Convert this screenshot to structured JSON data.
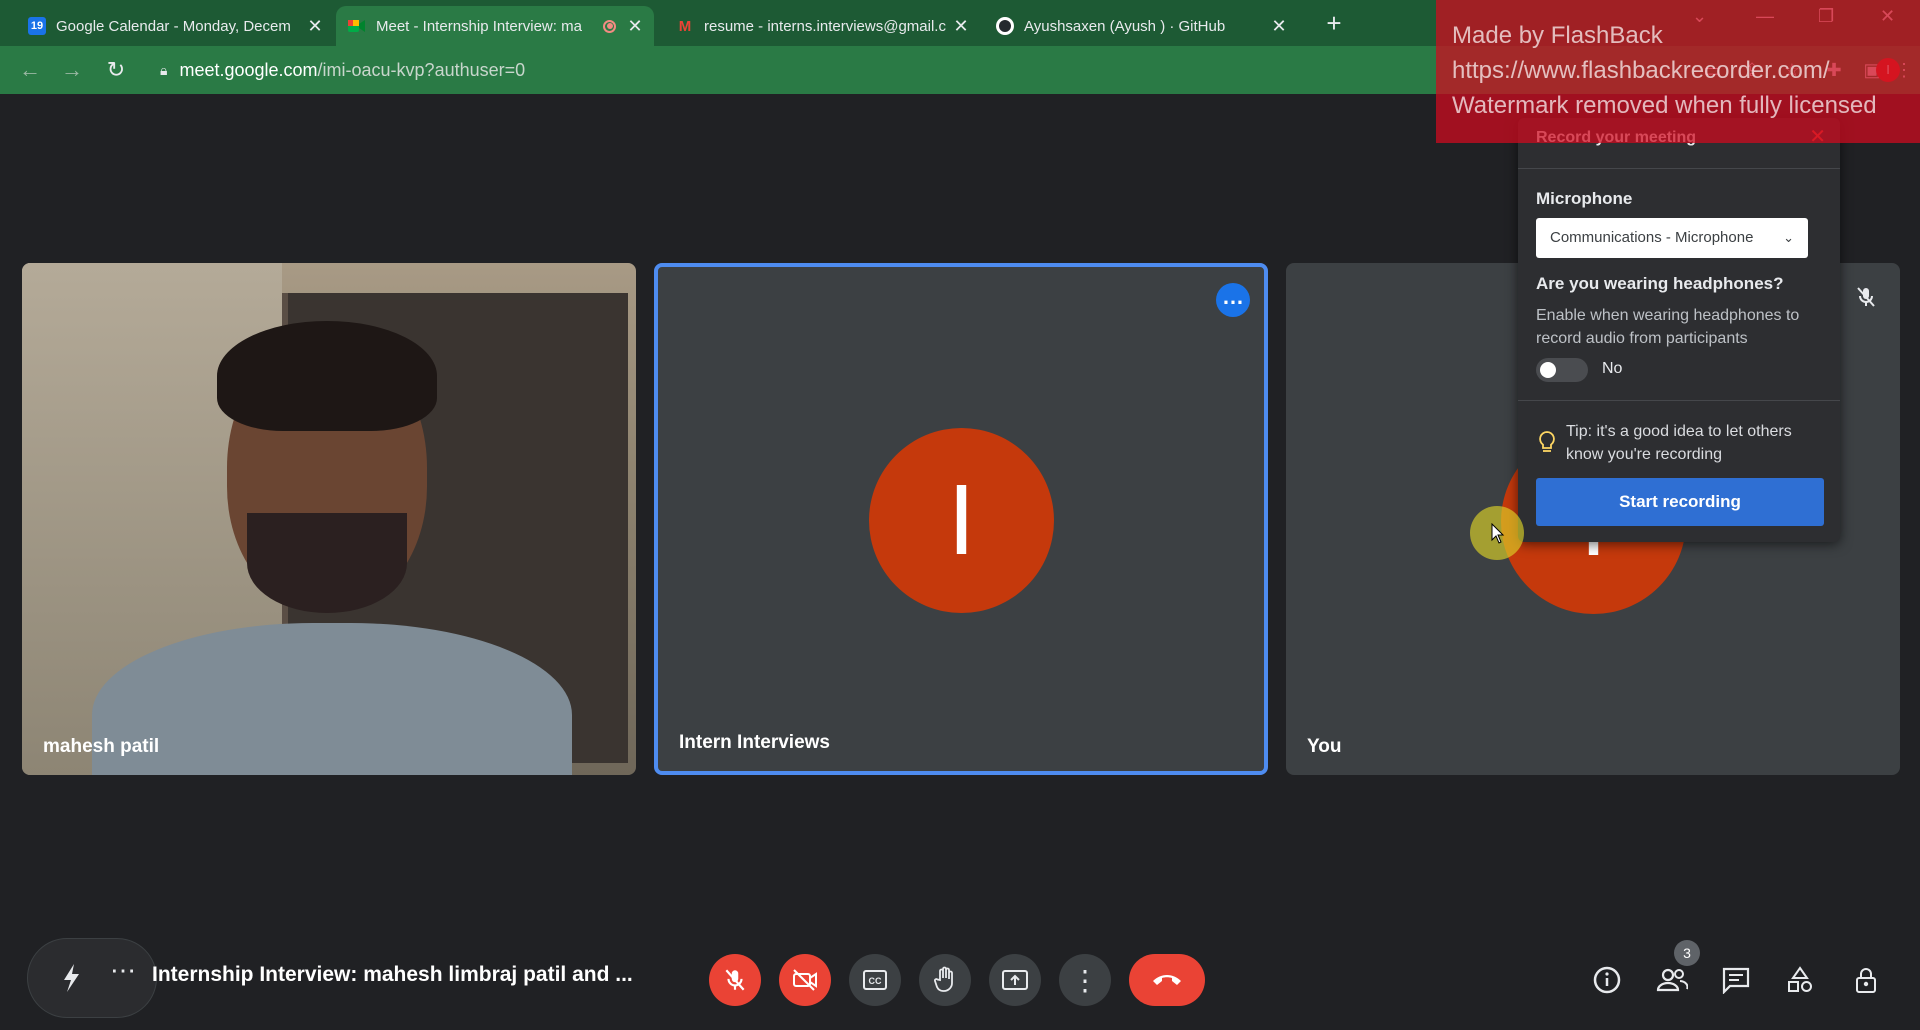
{
  "browser": {
    "tabs": [
      {
        "title": "Google Calendar - Monday, Decem",
        "favicon": "19"
      },
      {
        "title": "Meet - Internship Interview: ma",
        "favicon": "meet"
      },
      {
        "title": "resume - interns.interviews@gmail.c",
        "favicon": "M"
      },
      {
        "title": "Ayushsaxen (Ayush ) · GitHub",
        "favicon": "github"
      }
    ],
    "url_host": "meet.google.com",
    "url_path": "/imi-oacu-kvp?authuser=0",
    "profile_initial": "I"
  },
  "watermark": {
    "line1": "Made by FlashBack",
    "line2": "https://www.flashbackrecorder.com/",
    "line3": "Watermark removed when fully licensed"
  },
  "tiles": [
    {
      "name": "mahesh patil"
    },
    {
      "name": "Intern Interviews",
      "avatar": "I"
    },
    {
      "name": "You",
      "avatar": "I"
    }
  ],
  "record_popup": {
    "title": "Record your meeting",
    "mic_label": "Microphone",
    "mic_value": "Communications - Microphone",
    "headphones_title": "Are you wearing headphones?",
    "headphones_desc": "Enable when wearing headphones to record audio from participants",
    "toggle_value": "No",
    "tip": "Tip: it's a good idea to let others know you're recording",
    "start_button": "Start recording"
  },
  "meeting": {
    "title": "Internship Interview: mahesh limbraj patil and ...",
    "people_count": "3"
  },
  "colors": {
    "accent": "#1a73e8",
    "danger": "#ea4335",
    "avatar": "#c5390c"
  }
}
